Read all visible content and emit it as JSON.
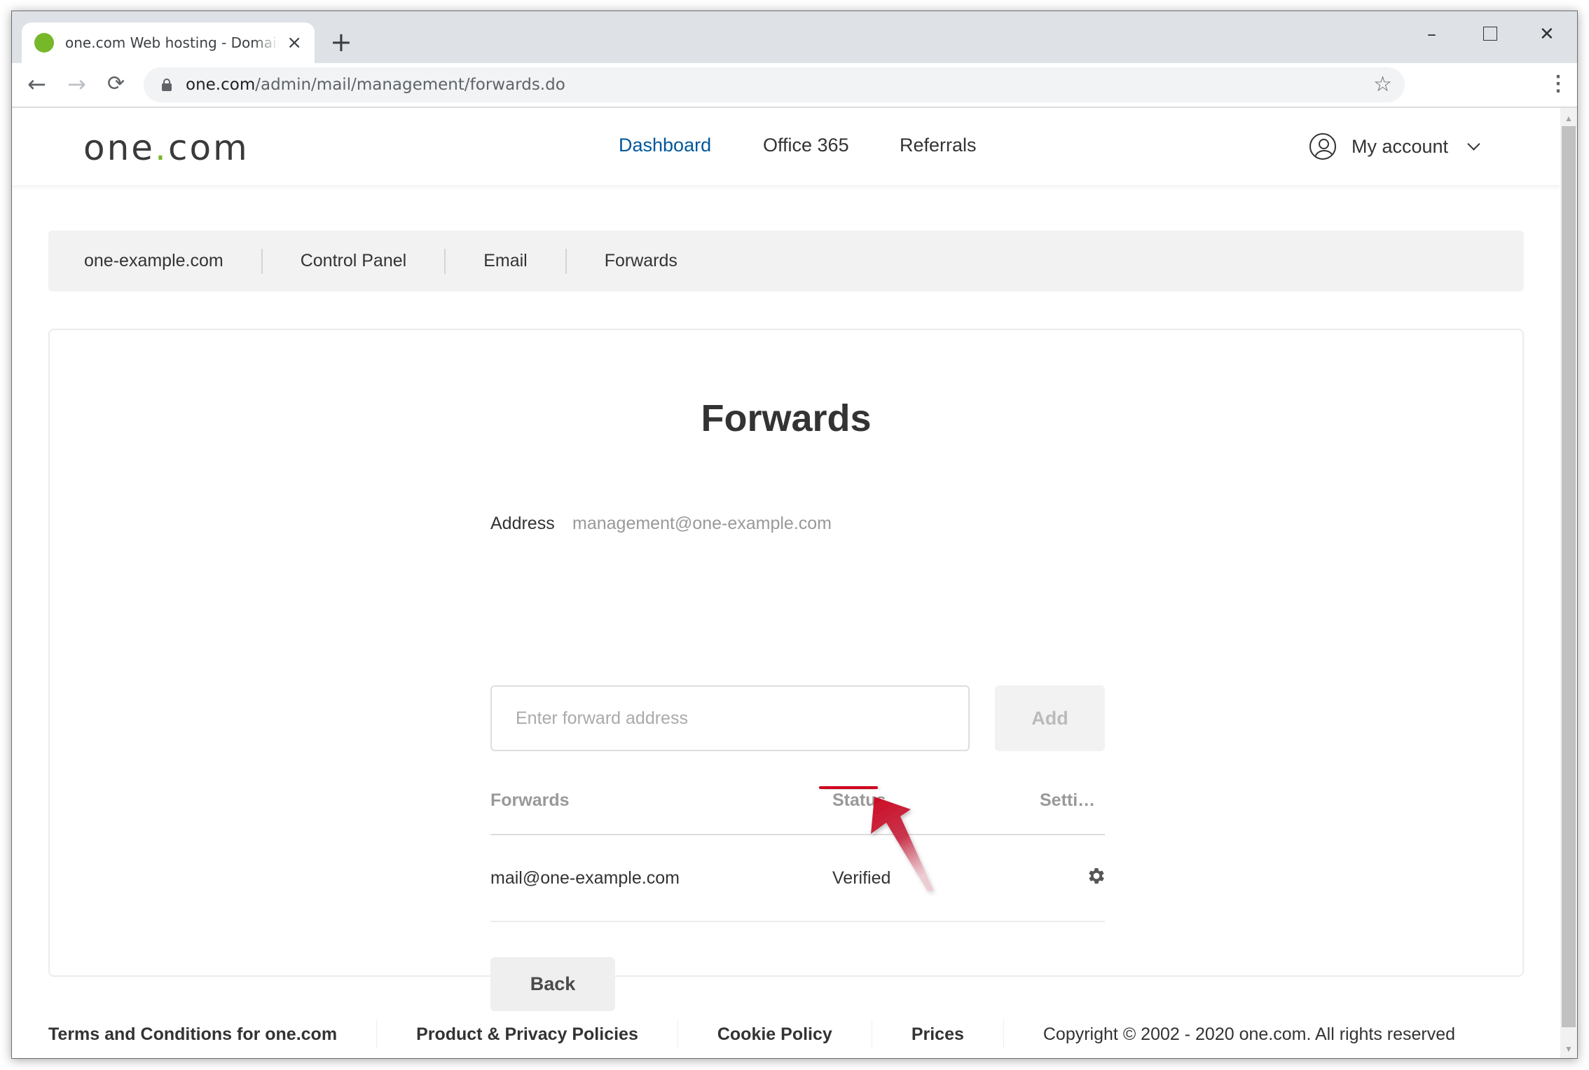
{
  "browser": {
    "tab_title": "one.com Web hosting  -  Domain",
    "url_host": "one.com",
    "url_path": "/admin/mail/management/forwards.do",
    "icons": {
      "favicon": "green-circle",
      "close": "×",
      "new_tab": "+",
      "back": "←",
      "forward": "→",
      "reload": "⟳",
      "star": "☆",
      "menu": "⋮",
      "minimize": "–",
      "close_window": "✕"
    },
    "scroll_up": "▲",
    "scroll_down": "▼"
  },
  "site": {
    "logo_pre": "one",
    "logo_dot": ".",
    "logo_post": "com",
    "nav": [
      {
        "label": "Dashboard",
        "active": true
      },
      {
        "label": "Office 365",
        "active": false
      },
      {
        "label": "Referrals",
        "active": false
      }
    ],
    "account_label": "My account",
    "brand_color": "#76b82a",
    "active_nav_color": "#00579c"
  },
  "breadcrumb": [
    "one-example.com",
    "Control Panel",
    "Email",
    "Forwards"
  ],
  "main": {
    "title": "Forwards",
    "address_label": "Address",
    "address_value": "management@one-example.com",
    "input_placeholder": "Enter forward address",
    "input_value": "",
    "add_label": "Add",
    "table": {
      "headers": [
        "Forwards",
        "Status",
        "Setti…"
      ],
      "rows": [
        {
          "forward": "mail@one-example.com",
          "status": "Verified",
          "settings_icon": "gear-icon"
        }
      ]
    },
    "back_label": "Back"
  },
  "annotation": {
    "target": "Verified",
    "color": "#d0021b"
  },
  "footer": {
    "links": [
      "Terms and Conditions for one.com",
      "Product & Privacy Policies",
      "Cookie Policy",
      "Prices"
    ],
    "copyright": "Copyright © 2002 - 2020 one.com. All rights reserved"
  }
}
